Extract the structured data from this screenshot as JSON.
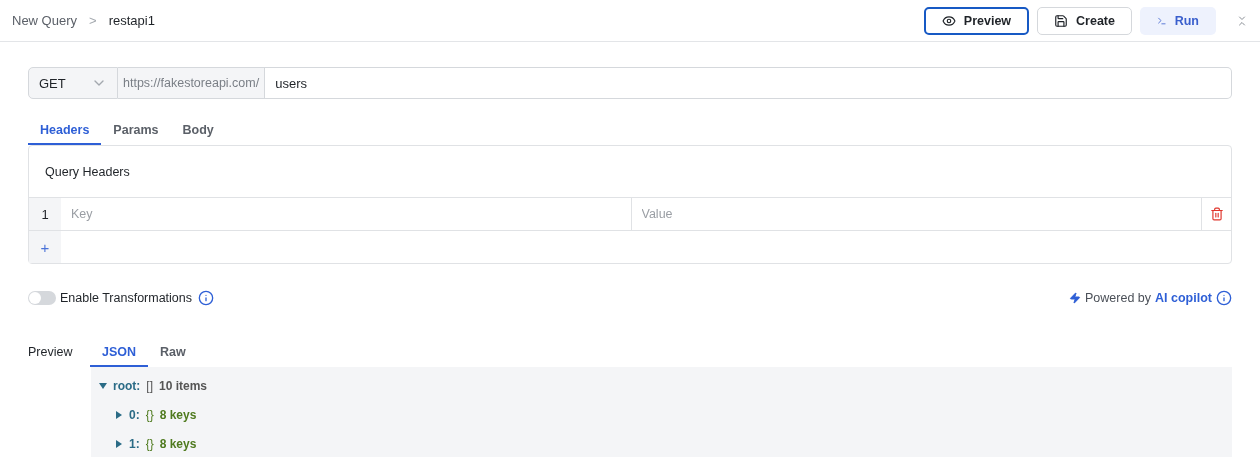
{
  "breadcrumb": {
    "parent": "New Query",
    "separator": ">",
    "current": "restapi1"
  },
  "actions": [
    {
      "label": "Preview",
      "kind": "focused"
    },
    {
      "label": "Create",
      "kind": "outline"
    },
    {
      "label": "Run",
      "kind": "soft"
    }
  ],
  "request": {
    "method": "GET",
    "base_url": "https://fakestoreapi.com/",
    "path": "users"
  },
  "tabs": [
    {
      "label": "Headers",
      "selected": true
    },
    {
      "label": "Params",
      "selected": false
    },
    {
      "label": "Body",
      "selected": false
    }
  ],
  "headers_panel": {
    "title": "Query Headers",
    "rows": [
      {
        "index": "1",
        "key_placeholder": "Key",
        "value_placeholder": "Value"
      }
    ],
    "add_label": "+"
  },
  "transformations": {
    "label": "Enable Transformations",
    "on": false
  },
  "copilot": {
    "prefix": "Powered by",
    "link": "AI copilot"
  },
  "preview": {
    "label": "Preview",
    "tabs": [
      {
        "label": "JSON",
        "selected": true
      },
      {
        "label": "Raw",
        "selected": false
      }
    ],
    "tree": [
      {
        "key": "root:",
        "bracket": "[]",
        "summary": "10 items",
        "expanded": true,
        "children": [
          {
            "key": "0:",
            "bracket": "{}",
            "summary": "8 keys",
            "expanded": false
          },
          {
            "key": "1:",
            "bracket": "{}",
            "summary": "8 keys",
            "expanded": false
          }
        ]
      }
    ]
  }
}
